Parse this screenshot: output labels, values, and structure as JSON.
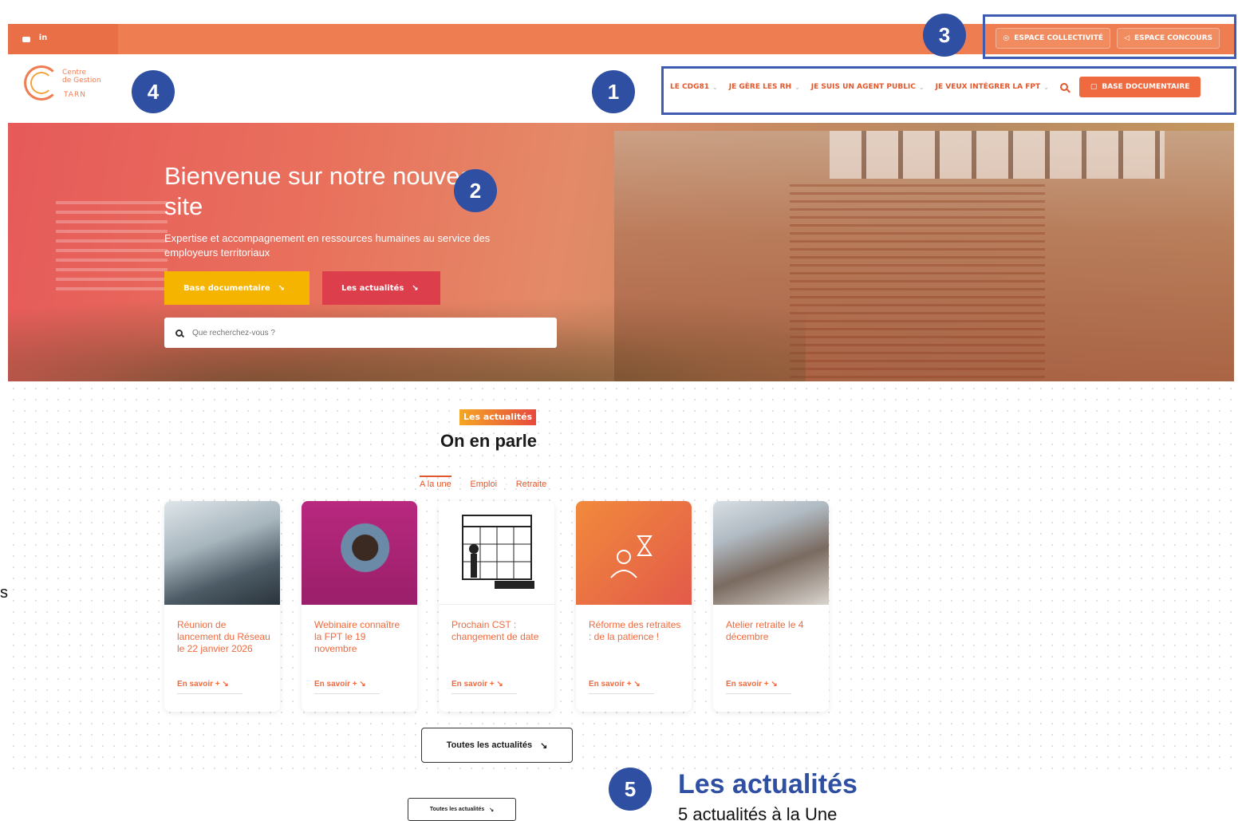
{
  "topbar": {
    "social": [
      "youtube-icon",
      "linkedin-icon"
    ],
    "linkedin_label": "in",
    "buttons": [
      {
        "label": "ESPACE COLLECTIVITÉ",
        "icon": "circle-icon"
      },
      {
        "label": "ESPACE CONCOURS",
        "icon": "send-icon"
      }
    ]
  },
  "logo": {
    "line1": "Centre",
    "line2": "de Gestion",
    "line3": "TARN"
  },
  "nav": {
    "items": [
      {
        "label": "LE CDG81"
      },
      {
        "label": "JE GÈRE LES RH"
      },
      {
        "label": "JE SUIS UN AGENT PUBLIC"
      },
      {
        "label": "JE VEUX INTÉGRER LA FPT"
      }
    ],
    "cta": "BASE DOCUMENTAIRE"
  },
  "hero": {
    "title": "Bienvenue sur notre nouveau site",
    "subtitle": "Expertise et accompagnement en ressources humaines au service des employeurs territoriaux",
    "btn_docs": "Base documentaire",
    "btn_news": "Les actualités",
    "search_placeholder": "Que recherchez-vous ?"
  },
  "news": {
    "tag": "Les actualités",
    "title": "On en parle",
    "tabs": [
      "A la une",
      "Emploi",
      "Retraite"
    ],
    "cards": [
      {
        "title": "Réunion de lancement du Réseau le 22 janvier 2026",
        "more": "En savoir +"
      },
      {
        "title": "Webinaire connaître la FPT le 19 novembre",
        "more": "En savoir +"
      },
      {
        "title": "Prochain CST : changement de date",
        "more": "En savoir +"
      },
      {
        "title": "Réforme des retraites : de la patience !",
        "more": "En savoir +"
      },
      {
        "title": "Atelier retraite le 4 décembre",
        "more": "En savoir +"
      }
    ],
    "all_btn": "Toutes les actualités",
    "all_btn_small": "Toutes les actualités"
  },
  "annotations": {
    "badges": [
      "1",
      "2",
      "3",
      "4",
      "5"
    ],
    "legend_title": "Les actualités",
    "legend_sub": "5 actualités à la Une",
    "side_text": "s"
  },
  "colors": {
    "primary": "#ef7d52",
    "accent": "#e2572b",
    "annotation": "#2f4fa3",
    "yellow_btn": "#f5b400",
    "red_btn": "#dc3e4b"
  }
}
